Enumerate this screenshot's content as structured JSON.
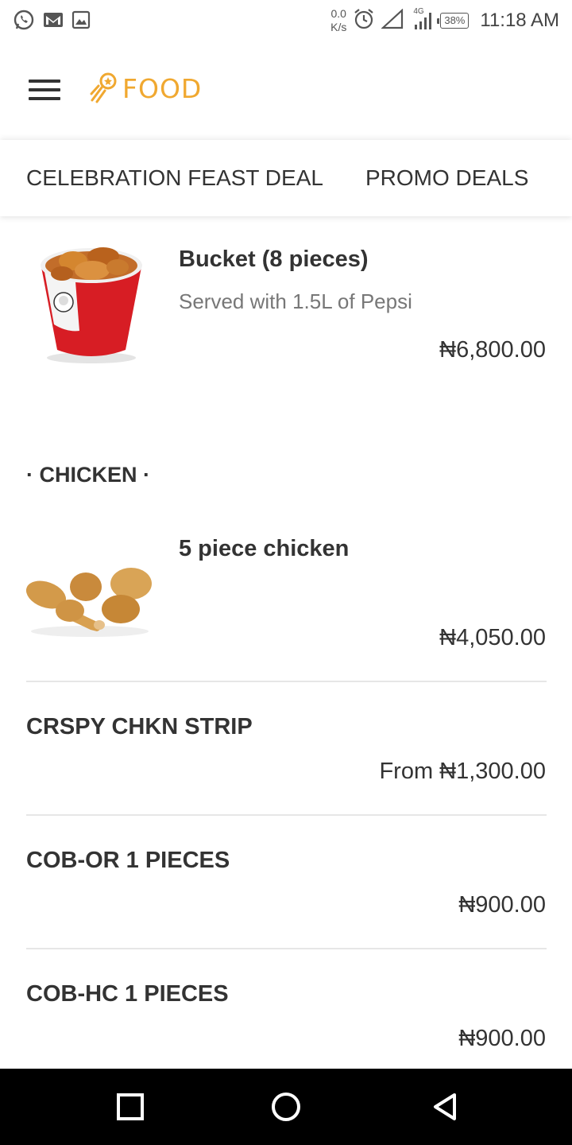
{
  "status_bar": {
    "net_speed_value": "0.0",
    "net_speed_unit": "K/s",
    "network": "4G",
    "battery": "38%",
    "time": "11:18 AM"
  },
  "app": {
    "logo_text": "FOOD",
    "accent_color": "#f0a830"
  },
  "tabs": [
    {
      "label": "CELEBRATION FEAST DEAL"
    },
    {
      "label": "PROMO DEALS"
    }
  ],
  "featured_items": [
    {
      "title": "Bucket (8 pieces)",
      "description": "Served with 1.5L of Pepsi",
      "price": "₦6,800.00"
    }
  ],
  "sections": [
    {
      "label": "· CHICKEN ·"
    }
  ],
  "chicken_items": [
    {
      "title": "5 piece chicken",
      "price": "₦4,050.00"
    },
    {
      "title": "CRSPY CHKN STRIP",
      "price": "From ₦1,300.00"
    },
    {
      "title": "COB-OR 1 PIECES",
      "price": "₦900.00"
    },
    {
      "title": "COB-HC 1 PIECES",
      "price": "₦900.00"
    }
  ]
}
